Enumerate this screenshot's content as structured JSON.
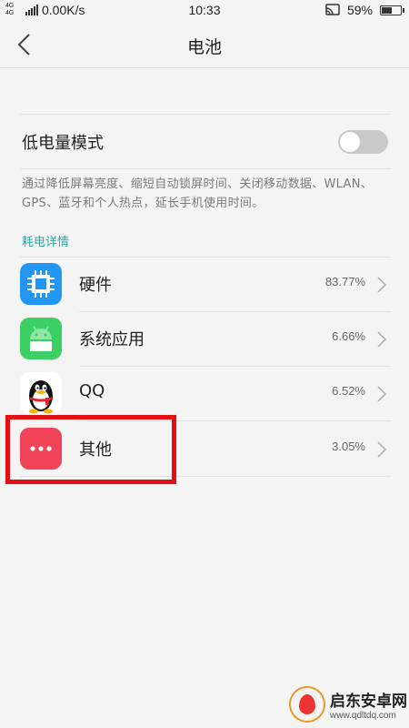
{
  "status_bar": {
    "network": "4G 4G",
    "speed": "0.00K/s",
    "time": "10:33",
    "battery": "59%",
    "battery_level": 0.59
  },
  "header": {
    "title": "电池",
    "back_icon": "chevron-left-icon"
  },
  "low_power_mode": {
    "label": "低电量模式",
    "enabled": false,
    "description": "通过降低屏幕亮度、缩短自动锁屏时间、关闭移动数据、WLAN、GPS、蓝牙和个人热点，延长手机使用时间。"
  },
  "section_title": "耗电详情",
  "items": [
    {
      "name": "硬件",
      "percent": "83.77%",
      "icon": "chip-icon",
      "color": "#2196f3"
    },
    {
      "name": "系统应用",
      "percent": "6.66%",
      "icon": "android-icon",
      "color": "#3ccf65"
    },
    {
      "name": "QQ",
      "percent": "6.52%",
      "icon": "qq-penguin-icon",
      "color": "#ffffff"
    },
    {
      "name": "其他",
      "percent": "3.05%",
      "icon": "more-dots-icon",
      "color": "#f24459"
    }
  ],
  "highlight_color": "#e30f16",
  "watermark": {
    "title": "启东安卓网",
    "url": "www.qdltdq.com"
  }
}
